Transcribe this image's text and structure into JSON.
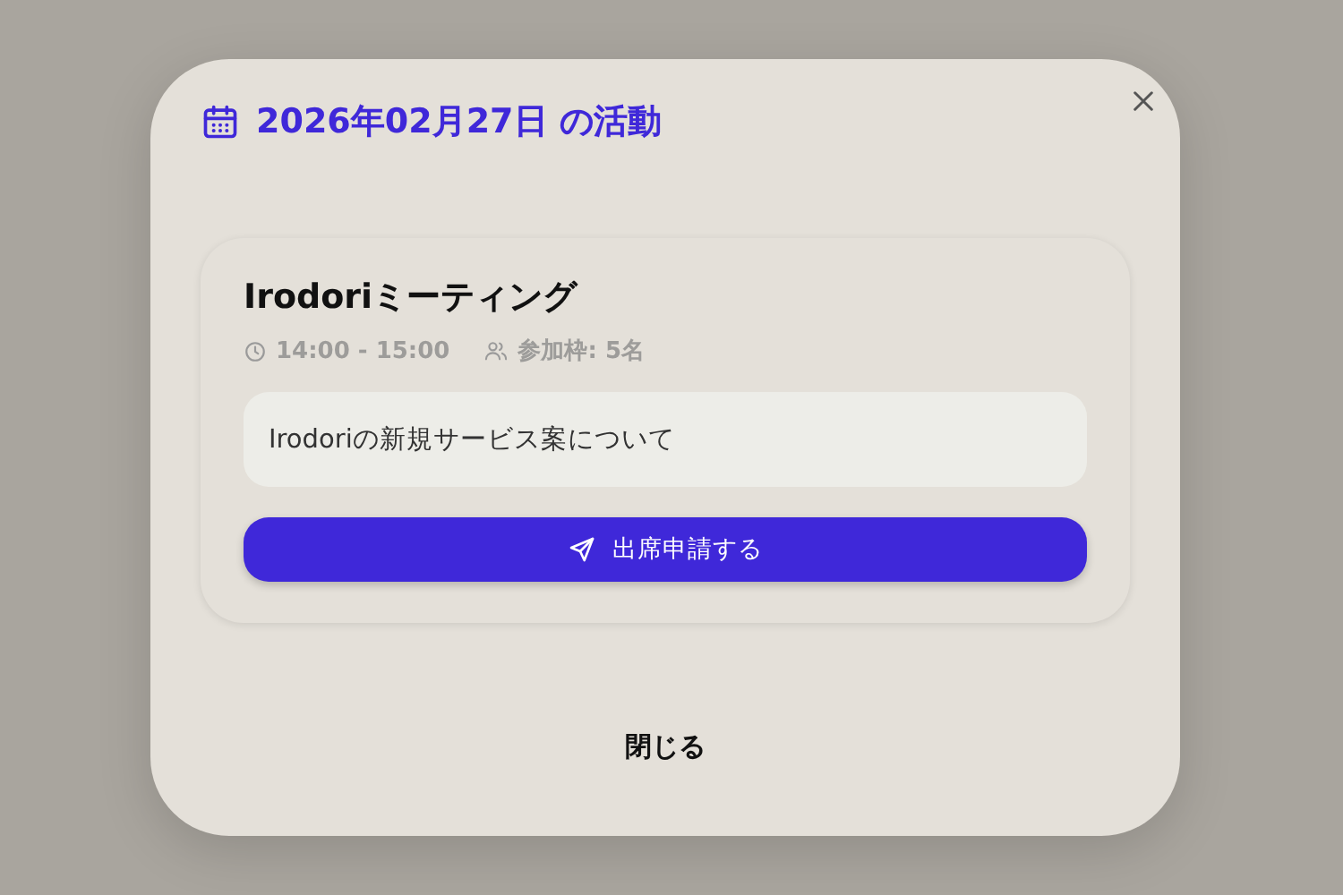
{
  "dialog": {
    "title": "2026年02月27日 の活動",
    "activities": [
      {
        "name": "Irodoriミーティング",
        "time": "14:00 - 15:00",
        "capacity": "参加枠: 5名",
        "description": "Irodoriの新規サービス案について",
        "action": "出席申請する"
      }
    ],
    "close_label": "閉じる"
  }
}
